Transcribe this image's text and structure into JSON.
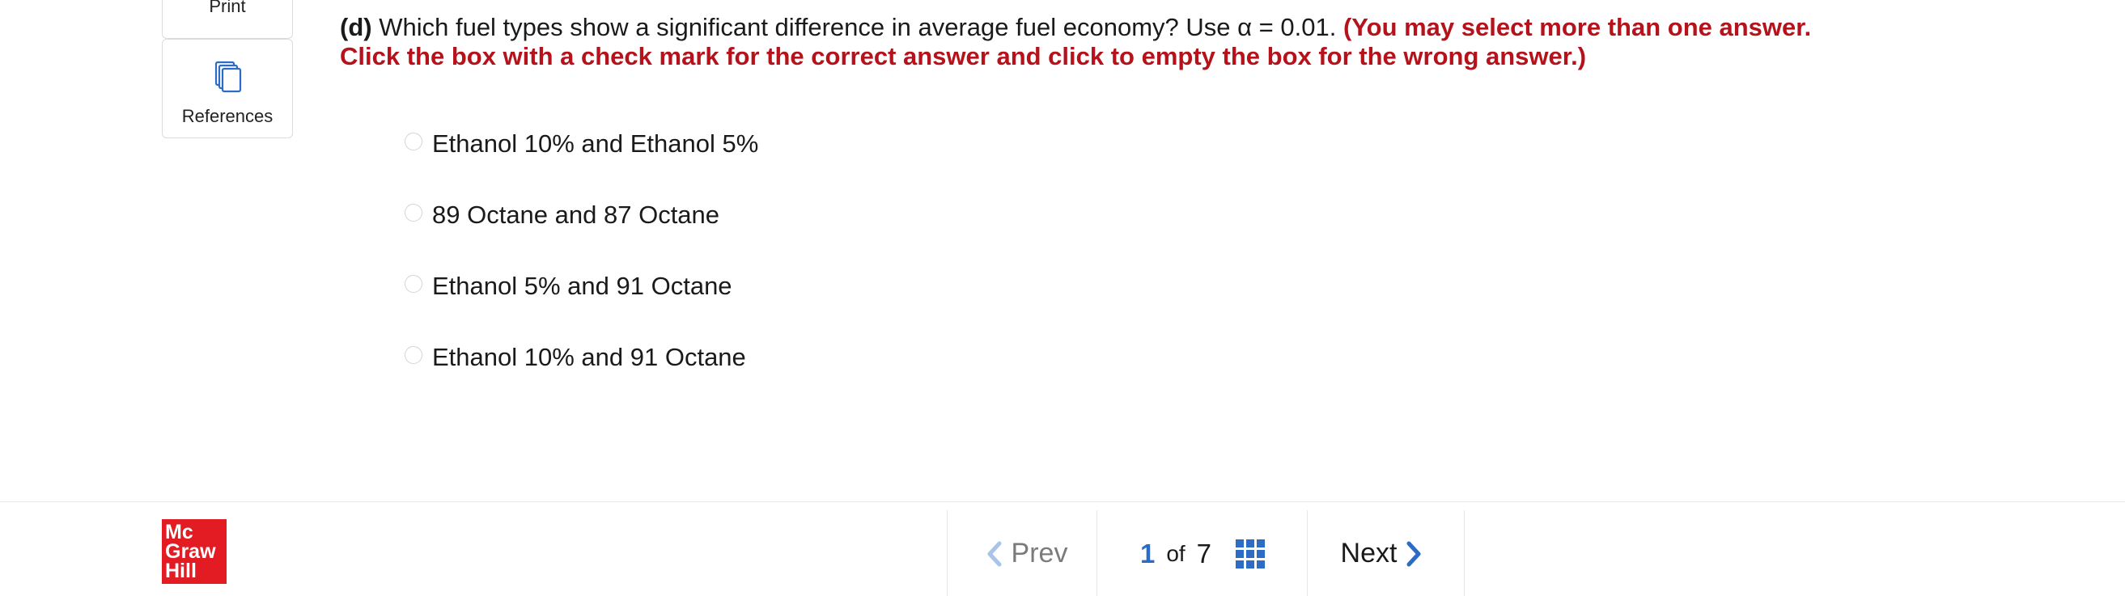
{
  "sidebar": {
    "print_label": "Print",
    "references_label": "References",
    "icons": {
      "references": "copy-pages-icon"
    }
  },
  "question": {
    "part": "(d)",
    "text": "Which fuel types show a significant difference in average fuel economy? Use α = 0.01.",
    "instruction": "(You may select more than one answer. Click the box with a check mark for the correct answer and click to empty the box for the wrong answer.)"
  },
  "options": [
    {
      "label": "Ethanol 10% and Ethanol 5%",
      "selected": false
    },
    {
      "label": "89 Octane and 87 Octane",
      "selected": false
    },
    {
      "label": "Ethanol 5% and 91 Octane",
      "selected": false
    },
    {
      "label": "Ethanol 10% and 91 Octane",
      "selected": false
    }
  ],
  "footer": {
    "logo": {
      "line1": "Mc",
      "line2": "Graw",
      "line3": "Hill",
      "color": "#e31b23"
    },
    "prev_label": "Prev",
    "next_label": "Next",
    "current_page": "1",
    "of_label": "of",
    "total_pages": "7",
    "icons": {
      "prev": "chevron-left-icon",
      "next": "chevron-right-icon",
      "grid": "grid-icon"
    }
  },
  "colors": {
    "accent_blue": "#2c6cc4",
    "instruction_red": "#b5121b"
  }
}
